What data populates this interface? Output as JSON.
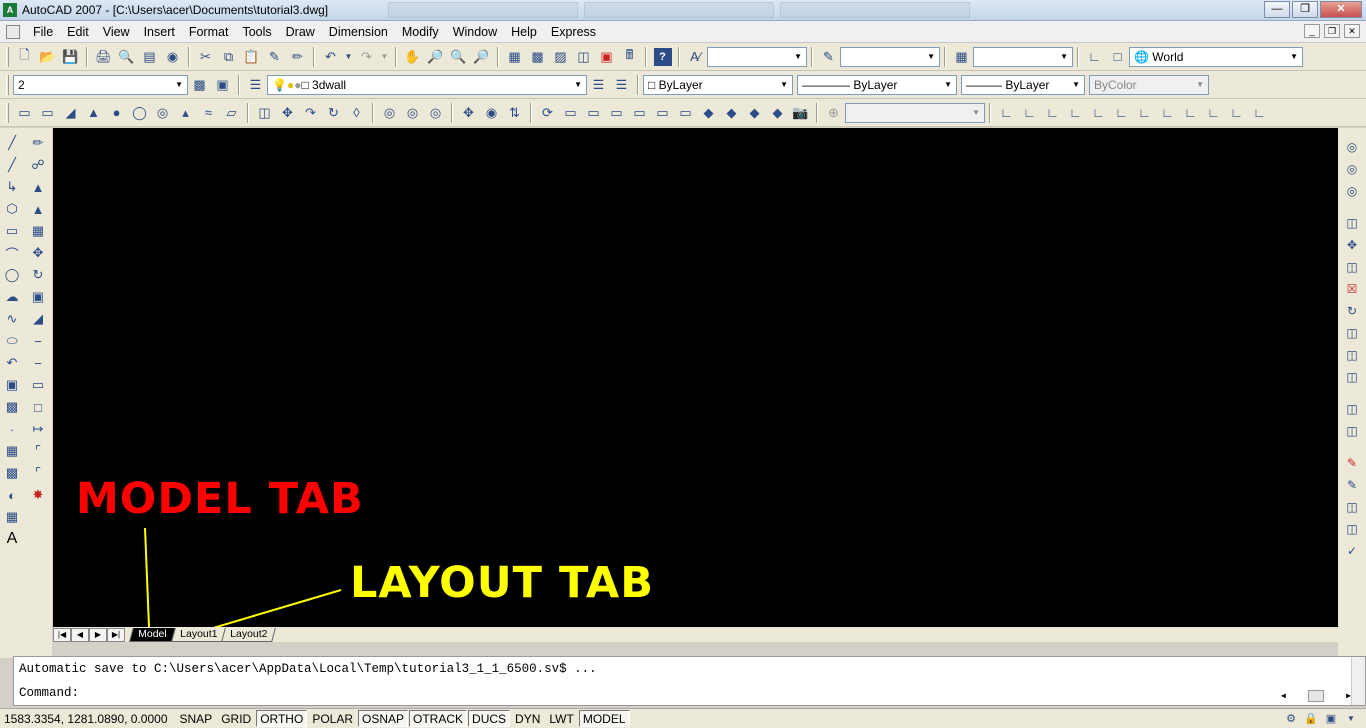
{
  "window": {
    "title": "AutoCAD 2007 - [C:\\Users\\acer\\Documents\\tutorial3.dwg]",
    "app_icon": "A"
  },
  "menu": [
    "File",
    "Edit",
    "View",
    "Insert",
    "Format",
    "Tools",
    "Draw",
    "Dimension",
    "Modify",
    "Window",
    "Help",
    "Express"
  ],
  "toolbar_row1": {
    "ucs_value": "World"
  },
  "toolbar_row2": {
    "layer_filter": "2",
    "layer_name": "3dwall",
    "color": "ByLayer",
    "linetype": "ByLayer",
    "lineweight": "ByLayer",
    "plotstyle": "ByColor"
  },
  "annotations": {
    "model_tab": "MODEL TAB",
    "layout_tab": "LAYOUT TAB",
    "model_color": "#ff0000",
    "layout_color": "#ffff00"
  },
  "tabs": {
    "model": "Model",
    "layout1": "Layout1",
    "layout2": "Layout2"
  },
  "command": {
    "history": "Automatic save to C:\\Users\\acer\\AppData\\Local\\Temp\\tutorial3_1_1_6500.sv$ ...",
    "prompt": "Command:"
  },
  "status": {
    "coords": "1583.3354, 1281.0890, 0.0000",
    "buttons": [
      "SNAP",
      "GRID",
      "ORTHO",
      "POLAR",
      "OSNAP",
      "OTRACK",
      "DUCS",
      "DYN",
      "LWT",
      "MODEL"
    ]
  }
}
